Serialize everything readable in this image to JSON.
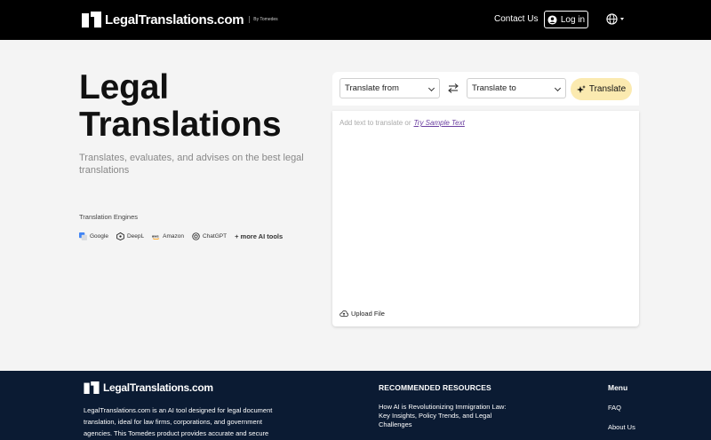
{
  "header": {
    "logo_text": "LegalTranslations.com",
    "logo_by": "By Tomedes",
    "contact_label": "Contact Us",
    "login_label": "Log in",
    "language_icon": "globe-icon"
  },
  "hero": {
    "title_line1": "Legal",
    "title_line2": "Translations",
    "subtitle": "Translates, evaluates, and advises on the best legal translations",
    "engines_label": "Translation Engines",
    "engines": [
      "Google",
      "DeepL",
      "Amazon",
      "ChatGPT"
    ],
    "more_tools": "+ more AI tools"
  },
  "translator": {
    "from_placeholder": "Translate from",
    "to_placeholder": "Translate to",
    "translate_button": "Translate",
    "text_placeholder": "Add text to translate or",
    "sample_link": "Try Sample Text",
    "upload_label": "Upload File",
    "accent_color": "#fbeab0"
  },
  "footer": {
    "logo_text": "LegalTranslations.com",
    "description": "LegalTranslations.com is an AI tool designed for legal document translation, ideal for law firms, corporations, and government agencies. This Tomedes product provides accurate and secure",
    "resources_title": "RECOMMENDED RESOURCES",
    "resource_link": "How AI is Revolutionizing Immigration Law: Key Insights, Policy Trends, and Legal Challenges",
    "menu_title": "Menu",
    "menu_items": [
      "FAQ",
      "About Us"
    ],
    "background_color": "#0b1b33"
  }
}
